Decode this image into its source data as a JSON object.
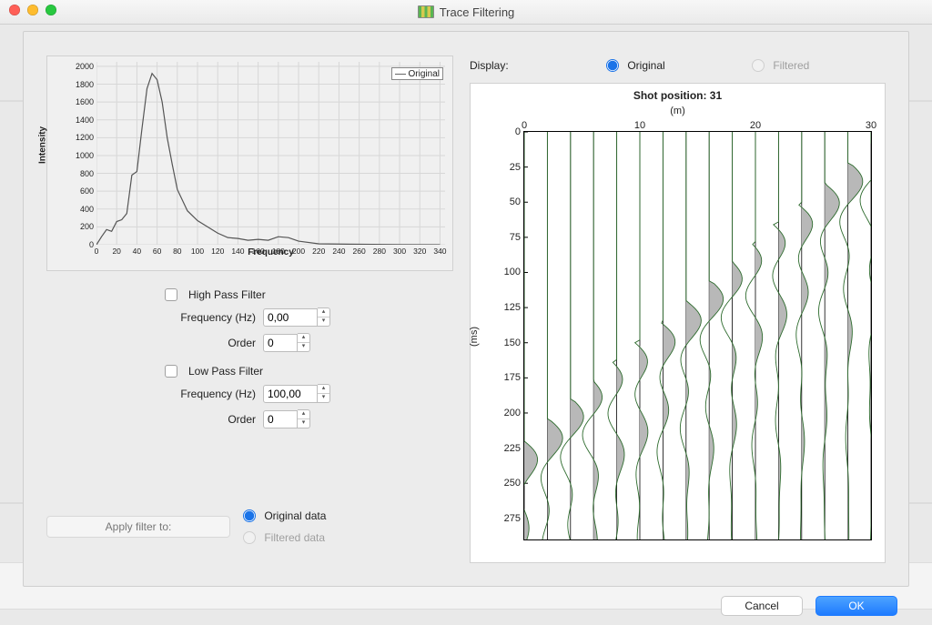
{
  "titlebar": {
    "title": "Trace Filtering"
  },
  "chart_data": {
    "type": "line",
    "title": "",
    "xlabel": "Frequency",
    "ylabel": "Intensity",
    "xlim": [
      0,
      345
    ],
    "ylim": [
      0,
      2050
    ],
    "xticks": [
      0,
      20,
      40,
      60,
      80,
      100,
      120,
      140,
      160,
      180,
      200,
      220,
      240,
      260,
      280,
      300,
      320,
      340
    ],
    "yticks": [
      0,
      200,
      400,
      600,
      800,
      1000,
      1200,
      1400,
      1600,
      1800,
      2000
    ],
    "legend": "Original",
    "x": [
      0,
      5,
      10,
      15,
      20,
      25,
      30,
      35,
      40,
      45,
      50,
      55,
      60,
      65,
      70,
      75,
      80,
      90,
      100,
      110,
      120,
      130,
      140,
      150,
      160,
      170,
      180,
      190,
      200,
      220,
      260,
      300,
      340
    ],
    "y": [
      0,
      90,
      170,
      150,
      260,
      280,
      350,
      780,
      820,
      1300,
      1750,
      1920,
      1850,
      1600,
      1200,
      900,
      620,
      380,
      270,
      200,
      130,
      80,
      70,
      50,
      60,
      50,
      90,
      80,
      40,
      10,
      5,
      2,
      0
    ]
  },
  "filters": {
    "highpass": {
      "label": "High Pass Filter",
      "freq_label": "Frequency (Hz)",
      "freq_value": "0,00",
      "order_label": "Order",
      "order_value": "0"
    },
    "lowpass": {
      "label": "Low Pass Filter",
      "freq_label": "Frequency (Hz)",
      "freq_value": "100,00",
      "order_label": "Order",
      "order_value": "0"
    }
  },
  "apply": {
    "pill": "Apply filter to:",
    "original": "Original data",
    "filtered": "Filtered data"
  },
  "display": {
    "label": "Display:",
    "original": "Original",
    "filtered": "Filtered"
  },
  "wiggle": {
    "title": "Shot position: 31",
    "sub": "(m)",
    "yaxis_label": "(ms)",
    "xticks": [
      0,
      10,
      20,
      30
    ],
    "xrange": [
      0,
      30
    ],
    "yticks": [
      0,
      25,
      50,
      75,
      100,
      125,
      150,
      175,
      200,
      225,
      250,
      275
    ],
    "yrange": [
      0,
      290
    ],
    "traces_x": [
      0,
      2,
      4,
      6,
      8,
      10,
      12,
      14,
      16,
      18,
      20,
      22,
      24,
      26,
      28,
      30
    ]
  },
  "buttons": {
    "cancel": "Cancel",
    "ok": "OK"
  }
}
